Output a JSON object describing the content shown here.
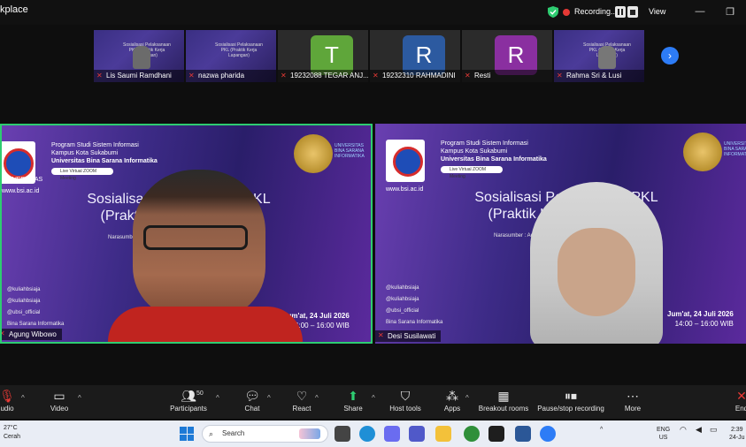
{
  "window": {
    "title_fragment": "kplace",
    "recording_label": "Recording...",
    "view_label": "View"
  },
  "colors": {
    "accent_blue": "#2d7cf6",
    "active_speaker_border": "#2ecc71",
    "recording_red": "#e53935",
    "slide_purple": "#3d2b87"
  },
  "thumbnails": [
    {
      "name": "Lis Saumi Ramdhani",
      "type": "video",
      "muted": true
    },
    {
      "name": "nazwa pharida",
      "type": "video",
      "muted": true
    },
    {
      "name": "19232088 TEGAR ANJ...",
      "type": "avatar",
      "letter": "T",
      "color": "#5fa63a",
      "muted": true
    },
    {
      "name": "19232310 RAHMADINI",
      "type": "avatar",
      "letter": "R",
      "color": "#2c5aa0",
      "muted": true
    },
    {
      "name": "Resti",
      "type": "avatar",
      "letter": "R",
      "color": "#8a2fa0",
      "muted": true
    },
    {
      "name": "Rahma Sri & Lusi",
      "type": "video",
      "muted": true
    }
  ],
  "thumb_slide_title": "Sosialisasi Pelaksanaan PKL (Praktik Kerja Lapangan)",
  "videos": [
    {
      "name": "Agung Wibowo",
      "slide_title_l1": "Sosialisasi Pelaksanaan PKL",
      "slide_title_l2": "(Praktik Kerja Lapangan)",
      "narasumber": "Narasumber : Agung Wibowo, S.Kom, M.Kom",
      "date": "Jum'at, 24 Juli 2026",
      "time": "14:00 – 16:00 WIB"
    },
    {
      "name": "Desi Susilawati",
      "slide_title_l1": "Sosialisasi Pelaksanaan PKL",
      "slide_title_l2": "(Praktik Kerja Lapangan)",
      "narasumber": "Narasumber : Agung Wibowo, S.Kom, M.Kom",
      "date": "Jum'at, 24 Juli 2026",
      "time": "14:00 – 16:00 WIB"
    }
  ],
  "slide": {
    "program_l1": "Program Studi Sistem Informasi",
    "program_l2": "Kampus Kota Sukabumi",
    "program_l3": "Universitas Bina Sarana Informatika",
    "zoom_pill": "Live Virtual ZOOM Meeting",
    "logo_caption": "www.bsi.ac.id",
    "universitas": "UNIVERSITAS",
    "socials": [
      "@kuliahbsiaja",
      "@kuliahbsiaja",
      "@ubsi_official",
      "Bina Sarana Informatika"
    ],
    "seal_text": "UNIVERSITAS BINA SARANA INFORMATIKA"
  },
  "toolbar": {
    "audio": "udio",
    "video": "Video",
    "participants": "Participants",
    "participants_count": "50",
    "chat": "Chat",
    "react": "React",
    "share": "Share",
    "host_tools": "Host tools",
    "apps": "Apps",
    "breakout": "Breakout rooms",
    "pause_record": "Pause/stop recording",
    "more": "More",
    "end": "End"
  },
  "taskbar": {
    "temp": "27°C",
    "weather": "Cerah",
    "search_placeholder": "Search",
    "lang_l1": "ENG",
    "lang_l2": "US",
    "time": "2:39",
    "date": "24-Ju"
  }
}
